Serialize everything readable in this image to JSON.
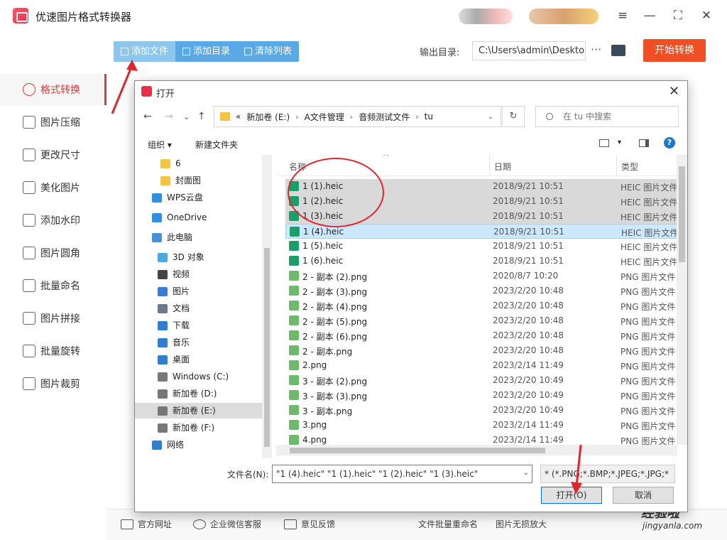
{
  "app": {
    "title": "优速图片格式转换器"
  },
  "window_controls": [
    "menu-icon",
    "minimize-icon",
    "maximize-icon",
    "close-icon"
  ],
  "toolbar": {
    "add_file": "添加文件",
    "add_dir": "添加目录",
    "clear_list": "清除列表"
  },
  "output": {
    "label": "输出目录:",
    "path": "C:\\Users\\admin\\Deskto",
    "more": "···"
  },
  "start_button": "开始转换",
  "sidebar": {
    "items": [
      {
        "label": "格式转换",
        "active": true
      },
      {
        "label": "图片压缩"
      },
      {
        "label": "更改尺寸"
      },
      {
        "label": "美化图片"
      },
      {
        "label": "添加水印"
      },
      {
        "label": "图片圆角"
      },
      {
        "label": "批量命名"
      },
      {
        "label": "图片拼接"
      },
      {
        "label": "批量旋转"
      },
      {
        "label": "图片裁剪"
      }
    ]
  },
  "footer": {
    "items": [
      "官方网址",
      "企业微信客服",
      "意见反馈",
      "文件批量重命名",
      "图片无损放大"
    ]
  },
  "watermark": {
    "line1": "经验啦",
    "line2": "jingyanla.com"
  },
  "dialog": {
    "title": "打开",
    "close": "✕",
    "nav": {
      "back": "←",
      "forward": "→",
      "down": "⌄",
      "up": "↑"
    },
    "address": {
      "prefix": "«",
      "parts": [
        "新加卷 (E:)",
        "A文件管理",
        "音频测试文件",
        "tu"
      ],
      "sep": "›"
    },
    "search_placeholder": "在 tu 中搜索",
    "commands": {
      "organize": "组织 ▾",
      "new_folder": "新建文件夹"
    },
    "tree": [
      {
        "label": "6",
        "icon": "folder"
      },
      {
        "label": "封面图",
        "icon": "folder"
      },
      {
        "label": "WPS云盘",
        "icon": "cloud"
      },
      {
        "label": "OneDrive",
        "icon": "cloud"
      },
      {
        "label": "此电脑",
        "icon": "pc"
      },
      {
        "label": "3D 对象",
        "icon": "cube"
      },
      {
        "label": "视频",
        "icon": "video"
      },
      {
        "label": "图片",
        "icon": "image"
      },
      {
        "label": "文档",
        "icon": "doc"
      },
      {
        "label": "下载",
        "icon": "download"
      },
      {
        "label": "音乐",
        "icon": "music"
      },
      {
        "label": "桌面",
        "icon": "desktop"
      },
      {
        "label": "Windows (C:)",
        "icon": "drive"
      },
      {
        "label": "新加卷 (D:)",
        "icon": "drive"
      },
      {
        "label": "新加卷 (E:)",
        "icon": "drive",
        "selected": true
      },
      {
        "label": "新加卷 (F:)",
        "icon": "drive"
      },
      {
        "label": "网络",
        "icon": "network"
      }
    ],
    "columns": {
      "name": "名称",
      "date": "日期",
      "type": "类型"
    },
    "files": [
      {
        "name": "1 (1).heic",
        "date": "2018/9/21 10:51",
        "type": "HEIC 图片文件",
        "kind": "heic",
        "state": "hl"
      },
      {
        "name": "1 (2).heic",
        "date": "2018/9/21 10:51",
        "type": "HEIC 图片文件",
        "kind": "heic",
        "state": "hl"
      },
      {
        "name": "1 (3).heic",
        "date": "2018/9/21 10:51",
        "type": "HEIC 图片文件",
        "kind": "heic",
        "state": "hl"
      },
      {
        "name": "1 (4).heic",
        "date": "2018/9/21 10:51",
        "type": "HEIC 图片文件",
        "kind": "heic",
        "state": "cur"
      },
      {
        "name": "1 (5).heic",
        "date": "2018/9/21 10:51",
        "type": "HEIC 图片文件",
        "kind": "heic"
      },
      {
        "name": "1 (6).heic",
        "date": "2018/9/21 10:51",
        "type": "HEIC 图片文件",
        "kind": "heic"
      },
      {
        "name": "2 - 副本 (2).png",
        "date": "2020/8/7 10:20",
        "type": "PNG 图片文件",
        "kind": "png"
      },
      {
        "name": "2 - 副本 (3).png",
        "date": "2023/2/20 10:48",
        "type": "PNG 图片文件",
        "kind": "png"
      },
      {
        "name": "2 - 副本 (4).png",
        "date": "2023/2/20 10:48",
        "type": "PNG 图片文件",
        "kind": "png"
      },
      {
        "name": "2 - 副本 (5).png",
        "date": "2023/2/20 10:48",
        "type": "PNG 图片文件",
        "kind": "png"
      },
      {
        "name": "2 - 副本 (6).png",
        "date": "2023/2/20 10:48",
        "type": "PNG 图片文件",
        "kind": "png"
      },
      {
        "name": "2 - 副本.png",
        "date": "2023/2/20 10:48",
        "type": "PNG 图片文件",
        "kind": "png"
      },
      {
        "name": "2.png",
        "date": "2023/2/14 11:49",
        "type": "PNG 图片文件",
        "kind": "png"
      },
      {
        "name": "3 - 副本 (2).png",
        "date": "2023/2/20 10:49",
        "type": "PNG 图片文件",
        "kind": "png"
      },
      {
        "name": "3 - 副本 (3).png",
        "date": "2023/2/20 10:49",
        "type": "PNG 图片文件",
        "kind": "png"
      },
      {
        "name": "3 - 副本.png",
        "date": "2023/2/20 10:49",
        "type": "PNG 图片文件",
        "kind": "png"
      },
      {
        "name": "3.png",
        "date": "2023/2/14 11:49",
        "type": "PNG 图片文件",
        "kind": "png"
      },
      {
        "name": "4.png",
        "date": "2023/2/14 11:49",
        "type": "PNG 图片文件",
        "kind": "png"
      }
    ],
    "filename_label": "文件名(N):",
    "filename_value": "\"1 (4).heic\" \"1 (1).heic\" \"1 (2).heic\" \"1 (3).heic\"",
    "filter": "* (*.PNG;*.BMP;*.JPEG;*.JPG;*",
    "open_button": "打开(O)",
    "cancel_button": "取消"
  },
  "colors": {
    "accent_red": "#f04e23",
    "toolbar_blue": "#5aa9e6",
    "annotation_red": "#e0262a"
  }
}
